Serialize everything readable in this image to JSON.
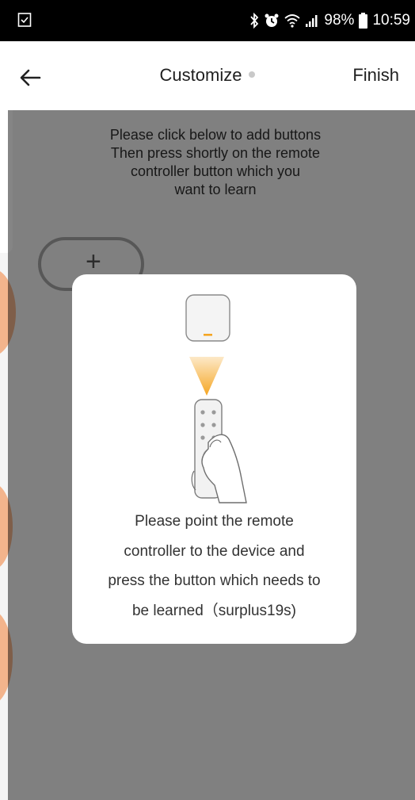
{
  "status_bar": {
    "battery_percent": "98%",
    "time": "10:59",
    "icons": [
      "checkbox-notification-icon",
      "bluetooth-icon",
      "alarm-icon",
      "wifi-icon",
      "signal-icon",
      "battery-icon"
    ]
  },
  "header": {
    "title": "Customize",
    "finish_label": "Finish",
    "back_icon": "arrow-left-icon"
  },
  "content": {
    "instruction_lines": [
      "Please click below to add buttons",
      "Then press shortly on the remote",
      "controller button which you",
      "want to learn"
    ],
    "add_button_glyph": "+"
  },
  "dialog": {
    "message_lines": [
      "Please point the remote",
      "controller to the device and",
      "press the button which needs to",
      "be learned（surplus19s)"
    ],
    "illustration": "remote-pointing-at-device-illustration"
  },
  "colors": {
    "status_bar": "#000000",
    "accent_orange": "#f5a623",
    "overlay": "rgba(0,0,0,0.48)",
    "dialog_bg": "#ffffff"
  }
}
